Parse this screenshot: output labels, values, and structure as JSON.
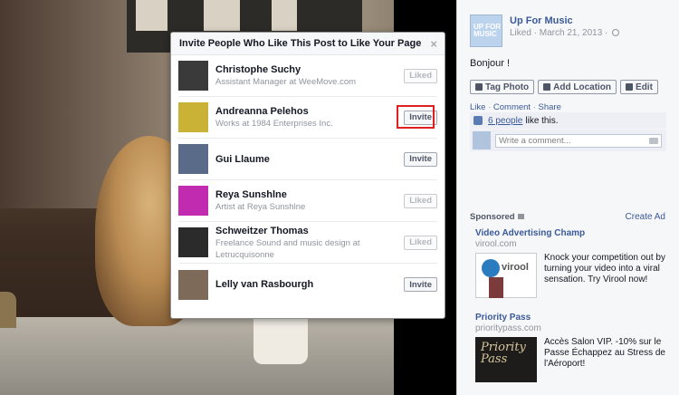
{
  "dialog": {
    "title": "Invite People Who Like This Post to Like Your Page",
    "close": "×",
    "people": [
      {
        "name": "Christophe Suchy",
        "sub": "Assistant Manager at WeeMove.com",
        "button": "Liked",
        "state": "liked",
        "avatar_color": "#3a3a3a"
      },
      {
        "name": "Andreanna Pelehos",
        "sub": "Works at 1984 Enterprises Inc.",
        "button": "Invite",
        "state": "invite",
        "avatar_color": "#c9b236"
      },
      {
        "name": "Gui Llaume",
        "sub": "",
        "button": "Invite",
        "state": "invite",
        "avatar_color": "#5a6b8a"
      },
      {
        "name": "Reya Sunshlne",
        "sub": "Artist at Reya Sunshlne",
        "button": "Liked",
        "state": "liked",
        "avatar_color": "#c02bb0"
      },
      {
        "name": "Schweitzer Thomas",
        "sub": "Freelance Sound and music design at Letrucquisonne",
        "button": "Liked",
        "state": "liked",
        "avatar_color": "#2b2b2b"
      },
      {
        "name": "Lelly van Rasbourgh",
        "sub": "",
        "button": "Invite",
        "state": "invite",
        "avatar_color": "#7d6a58"
      }
    ]
  },
  "post": {
    "page_name": "Up For Music",
    "avatar_text": "UP FOR MUSIC",
    "meta": "Liked · March 21, 2013 ·",
    "text": "Bonjour !",
    "tag_photo": "Tag Photo",
    "add_location": "Add Location",
    "edit": "Edit",
    "links": [
      "Like",
      "Comment",
      "Share"
    ],
    "likes_link": "6 people",
    "likes_rest": "like this.",
    "comment_placeholder": "Write a comment..."
  },
  "ads": {
    "sponsored_label": "Sponsored",
    "create_ad": "Create Ad",
    "items": [
      {
        "title": "Video Advertising Champ",
        "url": "virool.com",
        "body": "Knock your competition out by turning your video into a viral sensation. Try Virool now!",
        "brand": "virool"
      },
      {
        "title": "Priority Pass",
        "url": "prioritypass.com",
        "body": "Accès Salon VIP. -10% sur le Passe Échappez au Stress de l'Aéroport!",
        "brand": "Priority Pass"
      }
    ]
  },
  "colors": {
    "link": "#3b5998",
    "highlight": "#e02020"
  }
}
